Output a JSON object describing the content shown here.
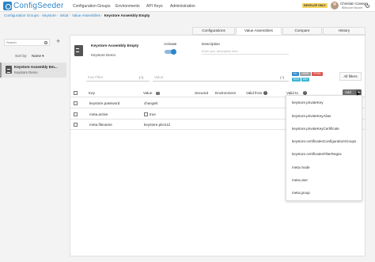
{
  "app": {
    "brand": "ConfigSeeder"
  },
  "nav": {
    "items": [
      "Configuration Groups",
      "Environments",
      "API Keys",
      "Administration"
    ]
  },
  "env_badge": "DEVELOP ONLY",
  "user": {
    "name": "Christian Cavegn",
    "role": "Bitbucket Nutzer"
  },
  "breadcrumb": [
    "Configuration Groups",
    "keystore",
    "initial",
    "Value Assemblies",
    "Keystore Assembly Empty"
  ],
  "sidebar": {
    "search_placeholder": "Search",
    "sort_label": "Sort by:",
    "sort_value": "Name",
    "items": [
      {
        "title": "Keystore Assembly Em...",
        "subtitle": "Keystore Demo"
      }
    ]
  },
  "tabs": [
    "Configurations",
    "Value Assemblies",
    "Compare",
    "History"
  ],
  "active_tab": "Value Assemblies",
  "assembly": {
    "title": "Keystore Assembly Empty",
    "subtitle": "Keystore Demo",
    "activate_label": "Activate",
    "activate_on": true,
    "description_label": "Description",
    "description_placeholder": "Enter your description here"
  },
  "filters": {
    "key_placeholder": "Key Filter",
    "value_placeholder": "Value",
    "brackets": "[.*]",
    "chips": [
      {
        "label": "ALL",
        "color": "#2e86c8"
      },
      {
        "label": "NONE",
        "color": "#9e9e9e"
      },
      {
        "label": "PROD",
        "color": "#d9534f"
      },
      {
        "label": "TEST",
        "color": "#3fb5d6"
      },
      {
        "label": "DEV",
        "color": "#3fb5d6"
      }
    ],
    "all_filters": "All filters"
  },
  "table": {
    "headers": [
      "Key",
      "Value",
      "Secured",
      "Environment",
      "Valid from",
      "Valid to"
    ],
    "rows": [
      {
        "key": "keystore.password",
        "value": "changeit"
      },
      {
        "key": "meta.active",
        "value": "true"
      },
      {
        "key": "meta.filename",
        "value": "keystore.pkcs12"
      }
    ],
    "add_label": "Add"
  },
  "add_menu": [
    "keystore.privateKey",
    "keystore.privateKeyAlias",
    "keystore.privateKeyCertificate",
    "keystore.certificatesConfigurationGroups",
    "keystore.certificatesFilterRegex",
    "meta.mode",
    "meta.user",
    "meta.group"
  ]
}
